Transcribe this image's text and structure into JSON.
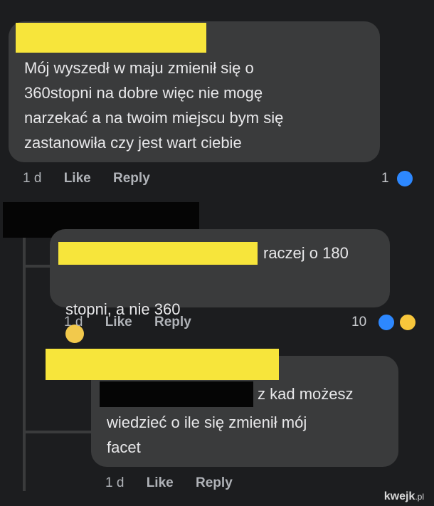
{
  "comments": [
    {
      "text": "Mój wyszedł w maju zmienił się o\n360stopni na dobre więc nie mogę\nnarzekać a na twoim miejscu bym się\nzastanowiła czy  jest wart ciebie",
      "time": "1 d",
      "like_label": "Like",
      "reply_label": "Reply",
      "reaction_count": "1"
    },
    {
      "text_first_line": "raczej o 180",
      "text_second_line": "stopni, a nie 360",
      "text_suffix": ".",
      "time": "1 d",
      "like_label": "Like",
      "reply_label": "Reply",
      "reaction_count": "10"
    },
    {
      "text_first_line": "z kad możesz",
      "text_rest": "wiedzieć o ile się zmienił mój\nfacet",
      "time": "1 d",
      "like_label": "Like",
      "reply_label": "Reply"
    }
  ],
  "watermark": {
    "brand": "kwejk",
    "tld": ".pl"
  },
  "colors": {
    "redaction_yellow": "#f7e53b",
    "redaction_black": "#050505",
    "bubble": "#3a3b3c",
    "like_blue": "#2d88ff"
  }
}
